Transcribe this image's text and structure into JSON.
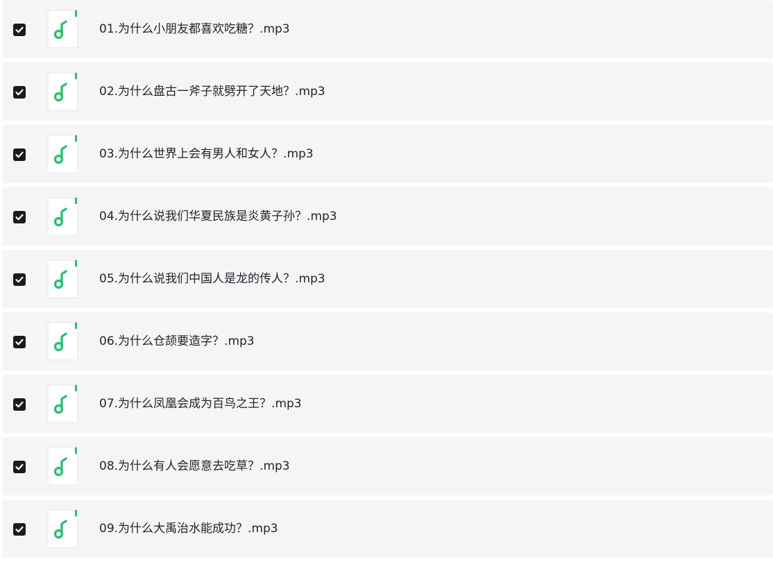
{
  "files": [
    {
      "name": "01.为什么小朋友都喜欢吃糖？.mp3",
      "checked": true,
      "icon": "music-note-icon"
    },
    {
      "name": "02.为什么盘古一斧子就劈开了天地？.mp3",
      "checked": true,
      "icon": "music-note-icon"
    },
    {
      "name": "03.为什么世界上会有男人和女人？.mp3",
      "checked": true,
      "icon": "music-note-icon"
    },
    {
      "name": "04.为什么说我们华夏民族是炎黄子孙？.mp3",
      "checked": true,
      "icon": "music-note-icon"
    },
    {
      "name": "05.为什么说我们中国人是龙的传人？.mp3",
      "checked": true,
      "icon": "music-note-icon"
    },
    {
      "name": "06.为什么仓颉要造字？.mp3",
      "checked": true,
      "icon": "music-note-icon"
    },
    {
      "name": "07.为什么凤凰会成为百鸟之王？.mp3",
      "checked": true,
      "icon": "music-note-icon"
    },
    {
      "name": "08.为什么有人会愿意去吃草？.mp3",
      "checked": true,
      "icon": "music-note-icon"
    },
    {
      "name": "09.为什么大禹治水能成功？.mp3",
      "checked": true,
      "icon": "music-note-icon"
    }
  ],
  "colors": {
    "row_background": "#f5f5f6",
    "checkbox_fill": "#1b1b1f",
    "icon_accent": "#2fbf71",
    "text": "#1f2329"
  }
}
